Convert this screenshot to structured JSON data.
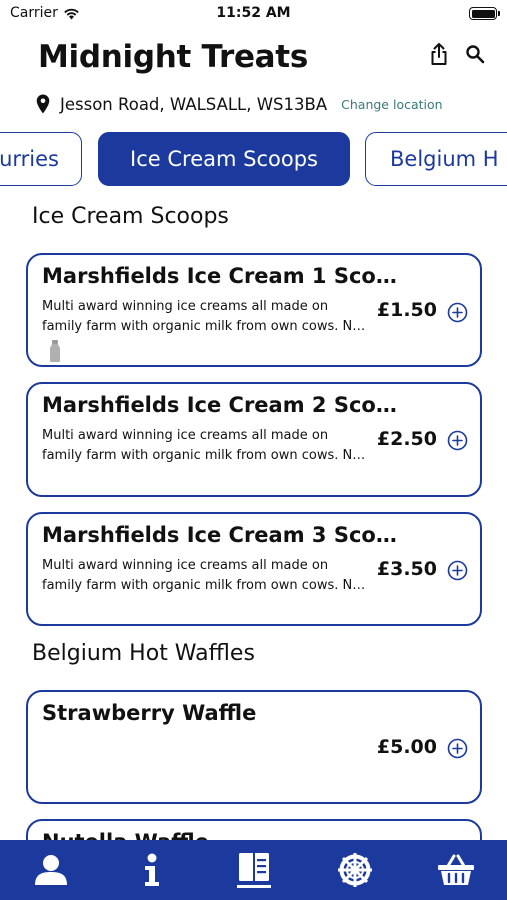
{
  "status": {
    "carrier": "Carrier",
    "time": "11:52 AM"
  },
  "header": {
    "title": "Midnight Treats"
  },
  "location": {
    "address": "Jesson Road, WALSALL, WS13BA",
    "change": "Change location"
  },
  "category_tabs": [
    {
      "label": "urries",
      "active": false
    },
    {
      "label": "Ice Cream Scoops",
      "active": true
    },
    {
      "label": "Belgium H",
      "active": false
    }
  ],
  "sections": [
    {
      "title": "Ice Cream Scoops",
      "items": [
        {
          "name": "Marshfields Ice Cream 1 Sco…",
          "desc_line1": "Multi award winning ice creams all made on",
          "desc_line2": "family farm with organic milk from own cows. N…",
          "price": "£1.50"
        },
        {
          "name": "Marshfields Ice Cream 2 Sco…",
          "desc_line1": "Multi award winning ice creams all made on",
          "desc_line2": "family farm with organic milk from own cows. N…",
          "price": "£2.50"
        },
        {
          "name": "Marshfields Ice Cream 3 Sco…",
          "desc_line1": "Multi award winning ice creams all made on",
          "desc_line2": "family farm with organic milk from own cows. N…",
          "price": "£3.50"
        }
      ]
    },
    {
      "title": "Belgium Hot Waffles",
      "items": [
        {
          "name": "Strawberry Waffle",
          "price": "£5.00"
        },
        {
          "name": "Nutella Waffle"
        }
      ]
    }
  ],
  "tabbar": {
    "items": [
      "profile-icon",
      "info-icon",
      "menu-icon",
      "settings-icon",
      "basket-icon"
    ],
    "active": "menu-icon"
  },
  "colors": {
    "primary": "#1c3a9e",
    "link": "#3a7a78",
    "background": "#ffffff"
  }
}
